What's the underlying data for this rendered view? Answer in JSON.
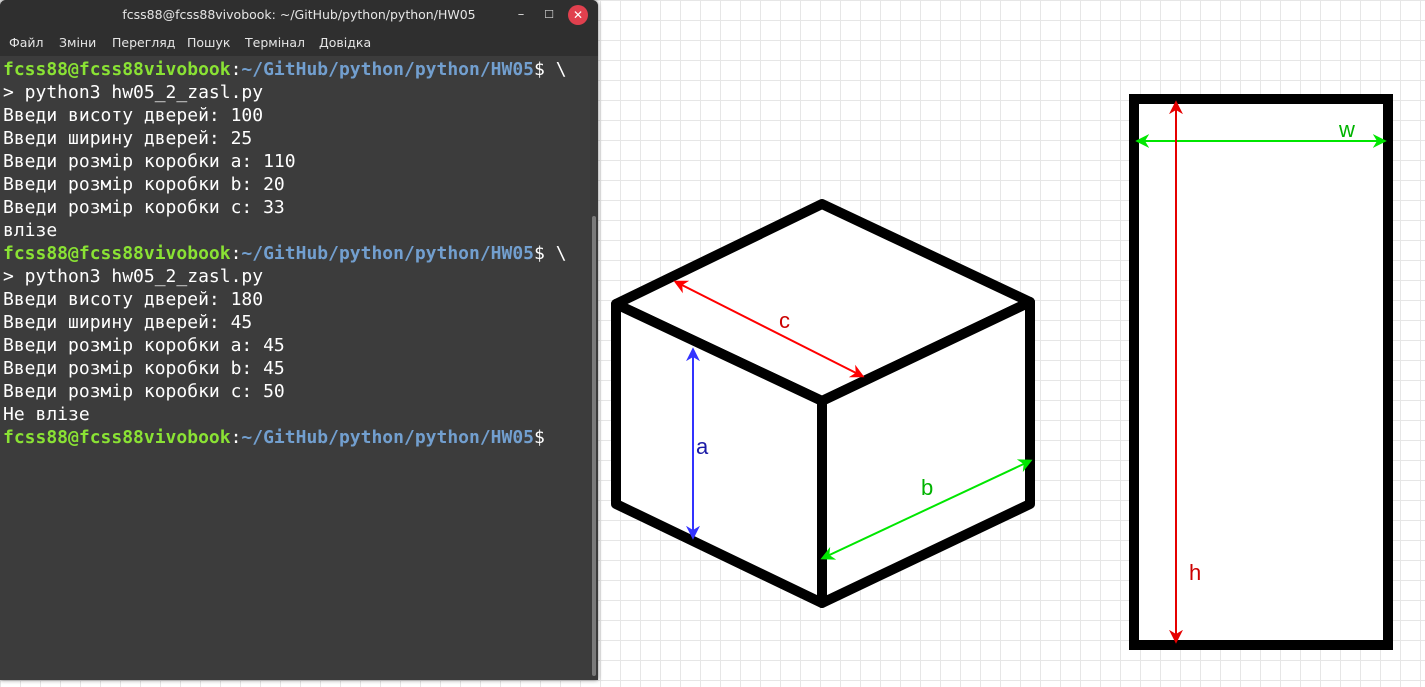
{
  "window": {
    "title": "fcss88@fcss88vivobook: ~/GitHub/python/python/HW05",
    "controls": {
      "minimize": "–",
      "maximize": "☐",
      "close": "✕"
    }
  },
  "menu": [
    "Файл",
    "Зміни",
    "Перегляд",
    "Пошук",
    "Термінал",
    "Довідка"
  ],
  "terminal": {
    "prompt_user": "fcss88@fcss88vivobook",
    "prompt_colon": ":",
    "prompt_path": "~/GitHub/python/python/HW05",
    "lines": [
      {
        "type": "prompt",
        "tail": "$ \\"
      },
      {
        "type": "text",
        "text": "> python3 hw05_2_zasl.py"
      },
      {
        "type": "text",
        "text": "Введи висоту дверей: 100"
      },
      {
        "type": "text",
        "text": "Введи ширину дверей: 25"
      },
      {
        "type": "text",
        "text": "Введи розмір коробки a: 110"
      },
      {
        "type": "text",
        "text": "Введи розмір коробки b: 20"
      },
      {
        "type": "text",
        "text": "Введи розмір коробки c: 33"
      },
      {
        "type": "text",
        "text": "влізе"
      },
      {
        "type": "prompt",
        "tail": "$ \\"
      },
      {
        "type": "text",
        "text": "> python3 hw05_2_zasl.py"
      },
      {
        "type": "text",
        "text": "Введи висоту дверей: 180"
      },
      {
        "type": "text",
        "text": "Введи ширину дверей: 45"
      },
      {
        "type": "text",
        "text": "Введи розмір коробки a: 45"
      },
      {
        "type": "text",
        "text": "Введи розмір коробки b: 45"
      },
      {
        "type": "text",
        "text": "Введи розмір коробки c: 50"
      },
      {
        "type": "text",
        "text": "Не влізе"
      },
      {
        "type": "prompt",
        "tail": "$"
      }
    ]
  },
  "diagram": {
    "labels": {
      "a": "a",
      "b": "b",
      "c": "c",
      "w": "w",
      "h": "h"
    },
    "colors": {
      "a": "#3333ff",
      "a_label": "#1a1aa6",
      "b": "#00e600",
      "b_label": "#00b300",
      "c": "#ff0000",
      "c_label": "#cc0000",
      "w": "#00e600",
      "w_label": "#00b300",
      "h": "#e60000",
      "h_label": "#cc0000",
      "outline": "#000000"
    }
  },
  "colors": {
    "terminal_bg": "#3c3c3c",
    "titlebar_bg": "#2f2f2f",
    "prompt_user": "#8ae234",
    "prompt_path": "#729fcf",
    "close_button": "#e0404e"
  }
}
